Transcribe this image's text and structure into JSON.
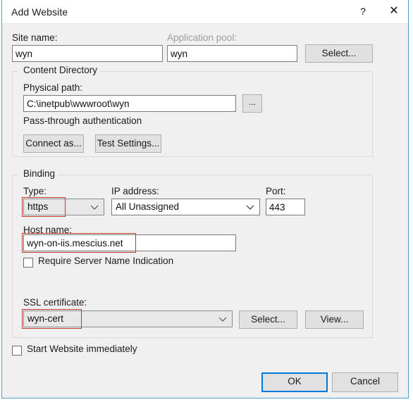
{
  "window": {
    "title": "Add Website",
    "help_icon": "?",
    "close_icon": "✕",
    "accent_color": "#0078d7",
    "annotation_color": "#c0392b"
  },
  "site_name": {
    "label": "Site name:",
    "value": "wyn",
    "placeholder": ""
  },
  "application_pool": {
    "label": "Application pool:",
    "value": "wyn",
    "select_button": "Select..."
  },
  "content_directory": {
    "group_title": "Content Directory",
    "physical_path": {
      "label": "Physical path:",
      "value": "C:\\inetpub\\wwwroot\\wyn"
    },
    "browse_button": "...",
    "pass_through": "Pass-through authentication",
    "connect_as_button": "Connect as...",
    "test_settings_button": "Test Settings..."
  },
  "binding": {
    "group_title": "Binding",
    "type": {
      "label": "Type:",
      "value": "https"
    },
    "ip_address": {
      "label": "IP address:",
      "value": "All Unassigned"
    },
    "port": {
      "label": "Port:",
      "value": "443"
    },
    "host_name": {
      "label": "Host name:",
      "value": "wyn-on-iis.mescius.net"
    },
    "require_sni": {
      "label": "Require Server Name Indication",
      "checked": false
    },
    "ssl_certificate": {
      "label": "SSL certificate:",
      "value": "wyn-cert",
      "select_button": "Select...",
      "view_button": "View..."
    }
  },
  "start_website": {
    "label": "Start Website immediately",
    "checked": false
  },
  "footer": {
    "ok_button": "OK",
    "cancel_button": "Cancel"
  }
}
